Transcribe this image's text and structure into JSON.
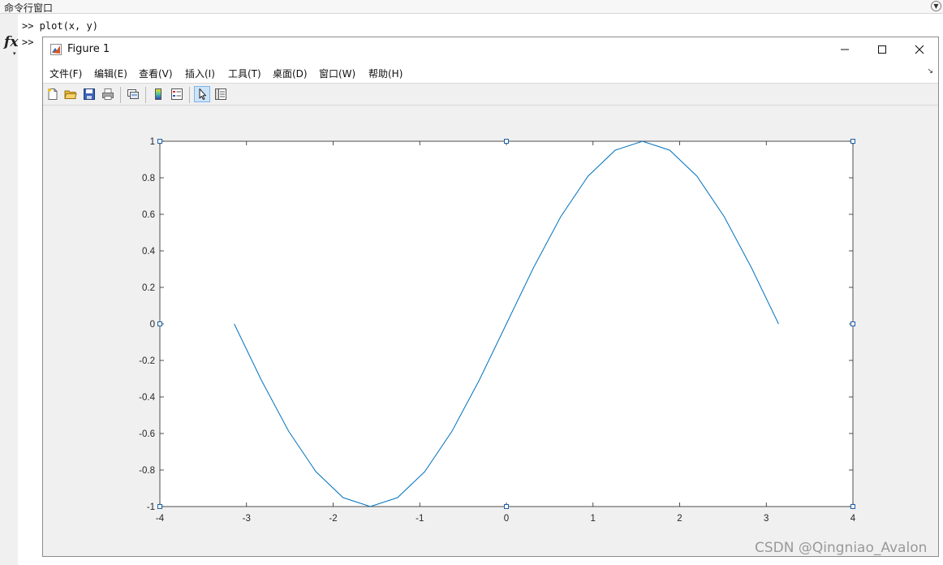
{
  "command_window": {
    "title": "命令行窗口",
    "lines": [
      ">> plot(x, y)",
      ">>"
    ],
    "fx_label": "fx"
  },
  "figure": {
    "title": "Figure 1",
    "window_controls": [
      "minimize",
      "maximize",
      "close"
    ],
    "menu": [
      {
        "label": "文件(F)"
      },
      {
        "label": "编辑(E)"
      },
      {
        "label": "查看(V)"
      },
      {
        "label": "插入(I)"
      },
      {
        "label": "工具(T)"
      },
      {
        "label": "桌面(D)"
      },
      {
        "label": "窗口(W)"
      },
      {
        "label": "帮助(H)"
      }
    ],
    "toolbar": [
      "new-figure-icon",
      "open-file-icon",
      "save-icon",
      "print-icon",
      "link-plot-icon",
      "colorbar-icon",
      "legend-icon",
      "edit-plot-arrow-icon",
      "property-inspector-icon"
    ],
    "line_color": "#0072bd"
  },
  "chart_data": {
    "type": "line",
    "series": [
      {
        "x": [
          -3.1416,
          -2.8274,
          -2.5133,
          -2.1991,
          -1.885,
          -1.5708,
          -1.2566,
          -0.9425,
          -0.6283,
          -0.3142,
          0,
          0.3142,
          0.6283,
          0.9425,
          1.2566,
          1.5708,
          1.885,
          2.1991,
          2.5133,
          2.8274,
          3.1416
        ],
        "y": [
          0,
          -0.309,
          -0.5878,
          -0.809,
          -0.9511,
          -1,
          -0.9511,
          -0.809,
          -0.5878,
          -0.309,
          0,
          0.309,
          0.5878,
          0.809,
          0.9511,
          1,
          0.9511,
          0.809,
          0.5878,
          0.309,
          0
        ]
      }
    ],
    "xlim": [
      -4,
      4
    ],
    "ylim": [
      -1,
      1
    ],
    "xticks": [
      "-4",
      "-3",
      "-2",
      "-1",
      "0",
      "1",
      "2",
      "3",
      "4"
    ],
    "yticks": [
      "-1",
      "-0.8",
      "-0.6",
      "-0.4",
      "-0.2",
      "0",
      "0.2",
      "0.4",
      "0.6",
      "0.8",
      "1"
    ],
    "grid": false,
    "selected_axes": true
  },
  "watermark": "CSDN @Qingniao_Avalon"
}
